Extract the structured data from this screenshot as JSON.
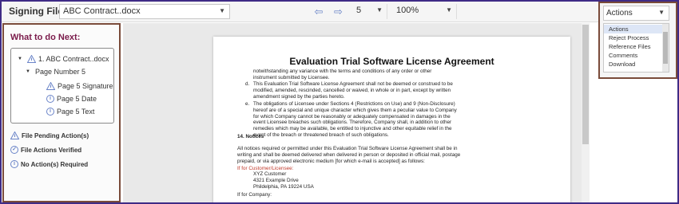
{
  "toolbar": {
    "signing_label": "Signing File :",
    "file_name": "ABC Contract..docx",
    "page": "5",
    "zoom": "100%",
    "prev_icon": "arrow-left-icon",
    "next_icon": "arrow-right-icon"
  },
  "left_panel": {
    "title": "What to do Next:",
    "tree": {
      "root": "1. ABC Contract..docx",
      "page": "Page Number 5",
      "items": [
        "Page 5 Signature",
        "Page 5 Date",
        "Page 5 Text"
      ]
    },
    "legend": [
      "File Pending Action(s)",
      "File Actions Verified",
      "No Action(s) Required"
    ]
  },
  "actions": {
    "selected": "Actions",
    "options": [
      "Actions",
      "Reject Process",
      "Reference Files",
      "Comments",
      "Download"
    ]
  },
  "document": {
    "title": "Evaluation Trial Software License Agreement",
    "para_top": [
      "notwithstanding any variance with the terms and conditions of any order or other",
      "instrument submitted by Licensee."
    ],
    "item_d_label": "d.",
    "item_d": [
      "This Evaluation Trial Software License Agreement shall not be deemed or construed to be",
      "modified, amended, rescinded, cancelled or waived, in whole or in part, except by written",
      "amendment signed by the parties hereto."
    ],
    "item_e_label": "e.",
    "item_e": [
      "The obligations of Licensee under Sections 4 (Restrictions on Use) and 9 (Non-Disclosure)",
      "hereof are of a special and unique character which gives them a peculiar value to Company",
      "for which Company cannot be reasonably or adequately compensated in damages in the",
      "event Licensee breaches such obligations. Therefore, Company shall, in addition to other",
      "remedies which may be available, be entitled to injunctive and other equitable relief in the",
      "event of the breach or threatened breach of such obligations."
    ],
    "notices_heading": "14. Notices",
    "notices": [
      "All notices required or permitted under this Evaluation Trial Software License Agreement shall be in",
      "writing and shall be deemed delivered when delivered in person or deposited in official mail, postage",
      "prepaid, or via approved electronic medium [for which e-mail is accepted] as follows:"
    ],
    "customer_label": "If for Customer/Licensee:",
    "customer": [
      "XYZ Customer",
      "4321 Example Drive",
      "Phildelphia, PA 19224 USA"
    ],
    "company_label": "If for Company:"
  },
  "colors": {
    "frame": "#3f2b86",
    "panel_border": "#7a4b3a",
    "title": "#7a1a4a",
    "accent": "#6a84c8"
  }
}
